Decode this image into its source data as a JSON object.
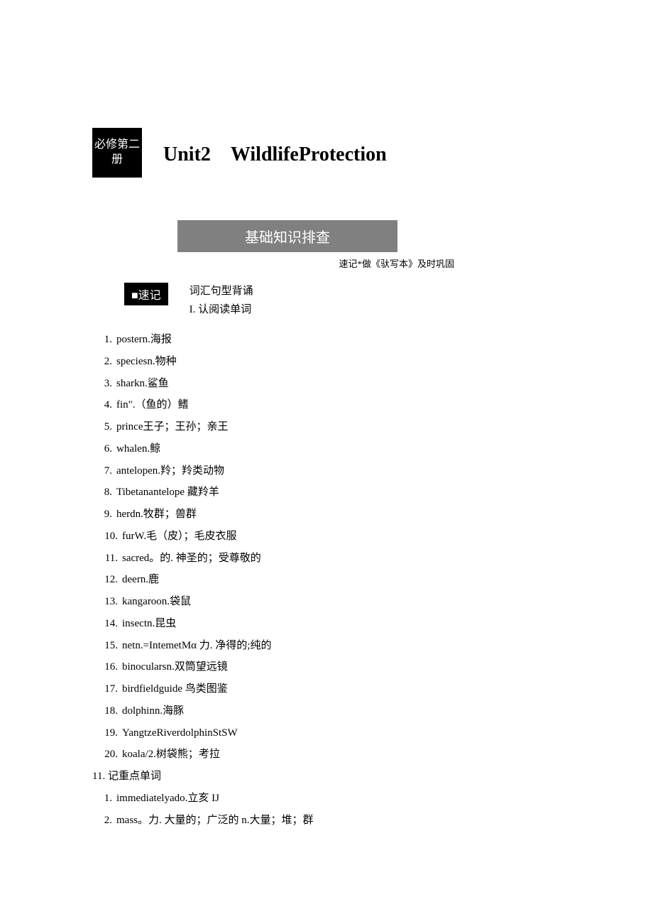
{
  "header": {
    "box_text": "必修第二册",
    "unit_title": "Unit2　WildlifeProtection"
  },
  "banner": "基础知识排查",
  "subtitle": "速记*做《驮写本》及时巩固",
  "suji": {
    "box": "■速记",
    "line1": "词汇句型背诵",
    "line2": "I. 认阅读单词"
  },
  "items1": [
    "postern.海报",
    "speciesn.物种",
    "sharkn.鲨鱼",
    "fin\".（鱼的）鳍",
    "prince王子；王孙；亲王",
    "whalen.鲸",
    "antelopen.羚；羚类动物",
    "Tibetanantelope 藏羚羊",
    "herdn.牧群；兽群",
    "furW.毛（皮）；毛皮衣服",
    "sacred。的. 神圣的；受尊敬的",
    "deern.鹿",
    "kangaroon.袋鼠",
    "insectn.昆虫",
    "netn.=IntemetMα 力. 净得的;纯的",
    "binocularsn.双筒望远镜",
    "birdfieldguide 鸟类图鉴",
    "dolphinn.海豚",
    "YangtzeRiverdolphinStSW",
    "koala/2.树袋熊；考拉"
  ],
  "section2_header": "11. 记重点单词",
  "items2": [
    "immediatelyado.立亥 IJ",
    "mass。力. 大量的；广泛的 n.大量；堆；群"
  ]
}
